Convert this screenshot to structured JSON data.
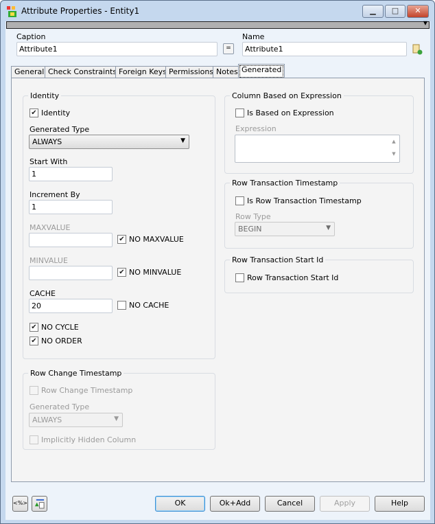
{
  "window": {
    "title": "Attribute Properties - Entity1",
    "minimize": "▁",
    "maximize": "□",
    "close": "✕"
  },
  "header": {
    "caption_label": "Caption",
    "caption_value": "Attribute1",
    "equal_label": "=",
    "name_label": "Name",
    "name_value": "Attribute1"
  },
  "tabs": [
    "General",
    "Check Constraints",
    "Foreign Keys",
    "Permissions",
    "Notes",
    "Generated"
  ],
  "identity": {
    "title": "Identity",
    "identity_label": "Identity",
    "generated_type_label": "Generated Type",
    "generated_type_value": "ALWAYS",
    "start_with_label": "Start With",
    "start_with_value": "1",
    "increment_by_label": "Increment By",
    "increment_by_value": "1",
    "maxvalue_label": "MAXVALUE",
    "maxvalue_value": "",
    "no_maxvalue_label": "NO MAXVALUE",
    "minvalue_label": "MINVALUE",
    "minvalue_value": "",
    "no_minvalue_label": "NO MINVALUE",
    "cache_label": "CACHE",
    "cache_value": "20",
    "no_cache_label": "NO CACHE",
    "no_cycle_label": "NO CYCLE",
    "no_order_label": "NO ORDER"
  },
  "row_change": {
    "title": "Row Change Timestamp",
    "checkbox_label": "Row Change Timestamp",
    "generated_type_label": "Generated Type",
    "generated_type_value": "ALWAYS",
    "hidden_label": "Implicitly Hidden Column"
  },
  "expression": {
    "title": "Column Based on Expression",
    "checkbox_label": "Is Based on Expression",
    "expression_label": "Expression",
    "expression_value": ""
  },
  "row_tx_ts": {
    "title": "Row Transaction Timestamp",
    "checkbox_label": "Is Row Transaction Timestamp",
    "row_type_label": "Row Type",
    "row_type_value": "BEGIN"
  },
  "row_tx_start": {
    "title": "Row Transaction Start Id",
    "checkbox_label": "Row Transaction Start Id"
  },
  "footer": {
    "macro_label": "<%>",
    "ok": "OK",
    "ok_add": "Ok+Add",
    "cancel": "Cancel",
    "apply": "Apply",
    "help": "Help"
  }
}
